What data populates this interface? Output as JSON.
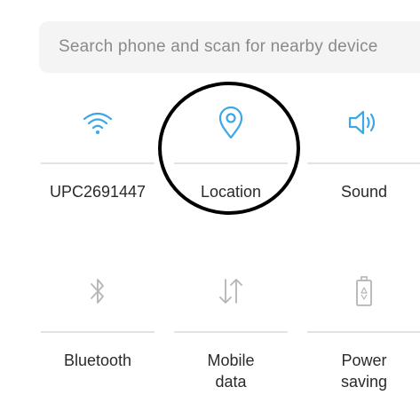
{
  "search": {
    "placeholder": "Search phone and scan for nearby device"
  },
  "tiles": [
    {
      "label": "UPC2691447",
      "icon": "wifi-icon",
      "active": true
    },
    {
      "label": "Location",
      "icon": "location-pin-icon",
      "active": true
    },
    {
      "label": "Sound",
      "icon": "speaker-icon",
      "active": true
    },
    {
      "label": "Bluetooth",
      "icon": "bluetooth-icon",
      "active": false
    },
    {
      "label": "Mobile\ndata",
      "icon": "mobile-data-icon",
      "active": false
    },
    {
      "label": "Power\nsaving",
      "icon": "battery-icon",
      "active": false
    }
  ],
  "colors": {
    "active_icon": "#3aa8e8",
    "inactive_icon": "#b5b5b5",
    "divider": "#e3e3e3",
    "annotation": "#000000"
  }
}
